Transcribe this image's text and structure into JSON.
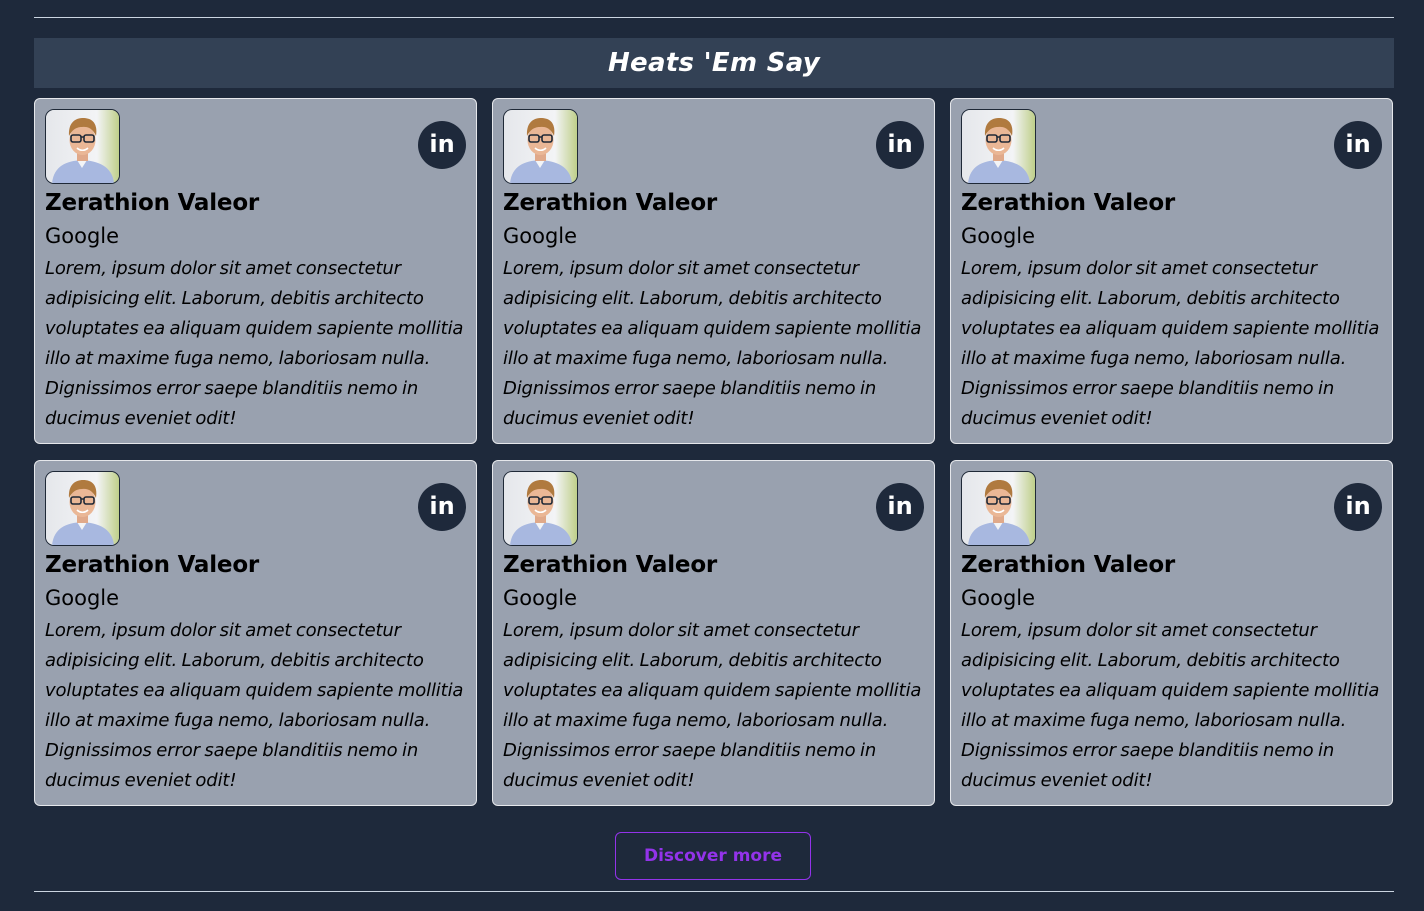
{
  "section": {
    "title": "Heats 'Em Say"
  },
  "colors": {
    "page_bg": "#1e293b",
    "header_bg": "#334155",
    "card_bg": "#99a1af",
    "accent_purple": "#9333ea",
    "linkedin_bg": "#1e293b"
  },
  "testimonials": [
    {
      "name": "Zerathion Valeor",
      "company": "Google",
      "quote": "Lorem, ipsum dolor sit amet consectetur adipisicing elit. Laborum, debitis architecto voluptates ea aliquam quidem sapiente mollitia illo at maxime fuga nemo, laboriosam nulla. Dignissimos error saepe blanditiis nemo in ducimus eveniet odit!",
      "social_icon": "linkedin-icon",
      "social_label": "in"
    },
    {
      "name": "Zerathion Valeor",
      "company": "Google",
      "quote": "Lorem, ipsum dolor sit amet consectetur adipisicing elit. Laborum, debitis architecto voluptates ea aliquam quidem sapiente mollitia illo at maxime fuga nemo, laboriosam nulla. Dignissimos error saepe blanditiis nemo in ducimus eveniet odit!",
      "social_icon": "linkedin-icon",
      "social_label": "in"
    },
    {
      "name": "Zerathion Valeor",
      "company": "Google",
      "quote": "Lorem, ipsum dolor sit amet consectetur adipisicing elit. Laborum, debitis architecto voluptates ea aliquam quidem sapiente mollitia illo at maxime fuga nemo, laboriosam nulla. Dignissimos error saepe blanditiis nemo in ducimus eveniet odit!",
      "social_icon": "linkedin-icon",
      "social_label": "in"
    },
    {
      "name": "Zerathion Valeor",
      "company": "Google",
      "quote": "Lorem, ipsum dolor sit amet consectetur adipisicing elit. Laborum, debitis architecto voluptates ea aliquam quidem sapiente mollitia illo at maxime fuga nemo, laboriosam nulla. Dignissimos error saepe blanditiis nemo in ducimus eveniet odit!",
      "social_icon": "linkedin-icon",
      "social_label": "in"
    },
    {
      "name": "Zerathion Valeor",
      "company": "Google",
      "quote": "Lorem, ipsum dolor sit amet consectetur adipisicing elit. Laborum, debitis architecto voluptates ea aliquam quidem sapiente mollitia illo at maxime fuga nemo, laboriosam nulla. Dignissimos error saepe blanditiis nemo in ducimus eveniet odit!",
      "social_icon": "linkedin-icon",
      "social_label": "in"
    },
    {
      "name": "Zerathion Valeor",
      "company": "Google",
      "quote": "Lorem, ipsum dolor sit amet consectetur adipisicing elit. Laborum, debitis architecto voluptates ea aliquam quidem sapiente mollitia illo at maxime fuga nemo, laboriosam nulla. Dignissimos error saepe blanditiis nemo in ducimus eveniet odit!",
      "social_icon": "linkedin-icon",
      "social_label": "in"
    }
  ],
  "cta": {
    "label": "Discover more"
  }
}
